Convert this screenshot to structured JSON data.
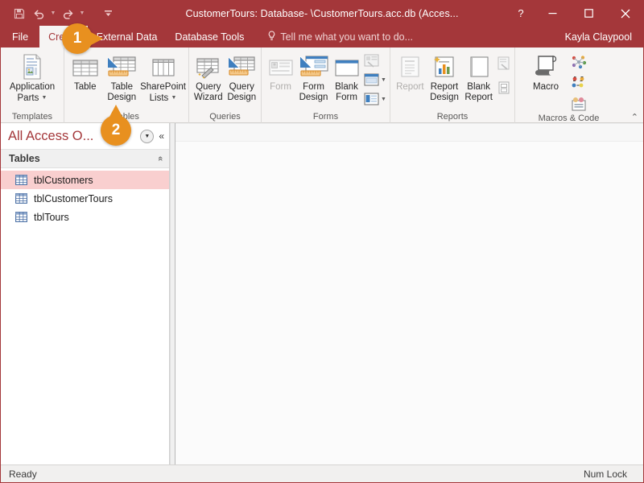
{
  "window": {
    "title": "CustomerTours: Database- \\CustomerTours.acc.db (Acces...",
    "help_label": "?",
    "minimize_label": "—",
    "maximize_label": "☐",
    "close_label": "✕"
  },
  "quick_access": {
    "save_label": "save-icon",
    "undo_label": "undo-icon",
    "redo_label": "redo-icon",
    "customize_label": "customize-icon"
  },
  "ribbon_tabs": {
    "file": "File",
    "items": [
      {
        "label": "Create",
        "active": true
      },
      {
        "label": "External Data",
        "active": false
      },
      {
        "label": "Database Tools",
        "active": false
      }
    ],
    "tell_me": "Tell me what you want to do...",
    "user": "Kayla Claypool",
    "collapse_label": "⌃"
  },
  "ribbon": {
    "groups": [
      {
        "name": "Templates",
        "buttons": [
          {
            "label_top": "Application",
            "label_bottom": "Parts",
            "has_caret": true,
            "disabled": false
          }
        ]
      },
      {
        "name": "Tables",
        "buttons": [
          {
            "label_top": "Table",
            "label_bottom": "",
            "has_caret": false,
            "disabled": false
          },
          {
            "label_top": "Table",
            "label_bottom": "Design",
            "has_caret": false,
            "disabled": false
          },
          {
            "label_top": "SharePoint",
            "label_bottom": "Lists",
            "has_caret": true,
            "disabled": false
          }
        ]
      },
      {
        "name": "Queries",
        "buttons": [
          {
            "label_top": "Query",
            "label_bottom": "Wizard",
            "has_caret": false,
            "disabled": false
          },
          {
            "label_top": "Query",
            "label_bottom": "Design",
            "has_caret": false,
            "disabled": false
          }
        ]
      },
      {
        "name": "Forms",
        "buttons": [
          {
            "label_top": "Form",
            "label_bottom": "",
            "has_caret": false,
            "disabled": true
          },
          {
            "label_top": "Form",
            "label_bottom": "Design",
            "has_caret": false,
            "disabled": false
          },
          {
            "label_top": "Blank",
            "label_bottom": "Form",
            "has_caret": false,
            "disabled": false
          }
        ],
        "small_buttons": [
          {
            "name": "form-wizard-button",
            "disabled": true,
            "has_caret": false
          },
          {
            "name": "navigation-button",
            "disabled": false,
            "has_caret": true
          },
          {
            "name": "more-forms-button",
            "disabled": false,
            "has_caret": true
          }
        ]
      },
      {
        "name": "Reports",
        "buttons": [
          {
            "label_top": "Report",
            "label_bottom": "",
            "has_caret": false,
            "disabled": true
          },
          {
            "label_top": "Report",
            "label_bottom": "Design",
            "has_caret": false,
            "disabled": false
          },
          {
            "label_top": "Blank",
            "label_bottom": "Report",
            "has_caret": false,
            "disabled": false
          }
        ],
        "small_buttons": [
          {
            "name": "report-wizard-button",
            "disabled": true,
            "has_caret": false
          },
          {
            "name": "labels-button",
            "disabled": true,
            "has_caret": false
          }
        ]
      },
      {
        "name": "Macros & Code",
        "buttons": [
          {
            "label_top": "Macro",
            "label_bottom": "",
            "has_caret": false,
            "disabled": false
          }
        ],
        "small_buttons": [
          {
            "name": "module-button",
            "disabled": false,
            "has_caret": false
          },
          {
            "name": "class-module-button",
            "disabled": false,
            "has_caret": false
          },
          {
            "name": "visual-basic-button",
            "disabled": false,
            "has_caret": false
          }
        ]
      }
    ]
  },
  "nav_pane": {
    "title": "All Access O...",
    "dropdown_label": "▼",
    "shutter_label": "«",
    "group_label": "Tables",
    "group_chevron": "«",
    "items": [
      {
        "label": "tblCustomers",
        "selected": true
      },
      {
        "label": "tblCustomerTours",
        "selected": false
      },
      {
        "label": "tblTours",
        "selected": false
      }
    ]
  },
  "status_bar": {
    "left": "Ready",
    "right": "Num Lock"
  },
  "callouts": [
    {
      "number": "1"
    },
    {
      "number": "2"
    }
  ],
  "colors": {
    "accent": "#a4373a",
    "badge": "#e8901f",
    "selection": "#f9cfcf",
    "ribbon_bg": "#f6f4f3"
  }
}
